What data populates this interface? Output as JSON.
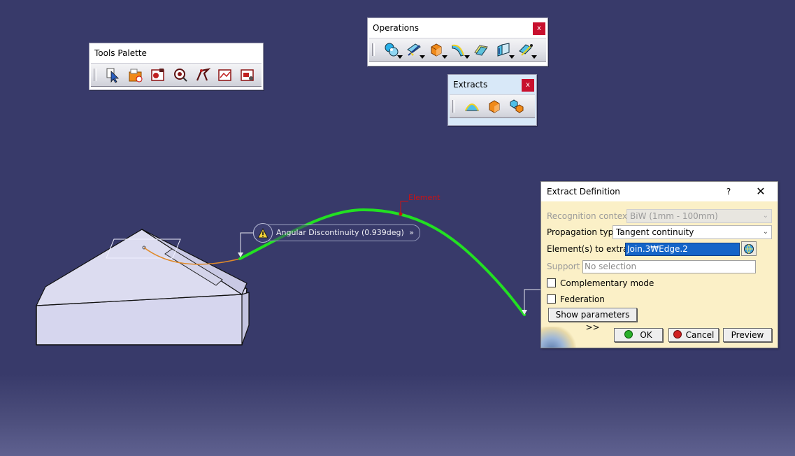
{
  "scene": {
    "colors": {
      "background": "#383a6a",
      "curve": "#22e022",
      "edge": "#e08a2a",
      "part": "#d3d3ec"
    }
  },
  "tools_palette": {
    "title": "Tools Palette",
    "icons": [
      "select-icon",
      "open-file-icon",
      "record-icon",
      "inspect-icon",
      "measure-icon",
      "analysis-icon",
      "edit-icon"
    ]
  },
  "operations": {
    "title": "Operations",
    "close": "x",
    "icons": [
      "join-icon",
      "split-icon",
      "extract-icon",
      "fillet-icon",
      "translate-icon",
      "extrapolate-icon",
      "pattern-icon"
    ]
  },
  "extracts": {
    "title": "Extracts",
    "close": "x",
    "icons": [
      "boundary-icon",
      "extract-icon",
      "multiple-extract-icon"
    ]
  },
  "annotation": {
    "text": "Angular Discontinuity (0.939deg)",
    "chevron": "»",
    "element_label": "Element"
  },
  "dialog": {
    "title": "Extract Definition",
    "help": "?",
    "close": "✕",
    "recognition_label": "Recognition context:",
    "recognition_value": "BiW (1mm - 100mm)",
    "propagation_label": "Propagation type:",
    "propagation_value": "Tangent continuity",
    "elements_label": "Element(s) to extract",
    "elements_value": "Join.3₩Edge.2",
    "support_label": "Support :",
    "support_value": "No selection",
    "complementary_label": "Complementary mode",
    "federation_label": "Federation",
    "show_params_label": "Show parameters >>",
    "ok_label": "OK",
    "cancel_label": "Cancel",
    "preview_label": "Preview"
  }
}
